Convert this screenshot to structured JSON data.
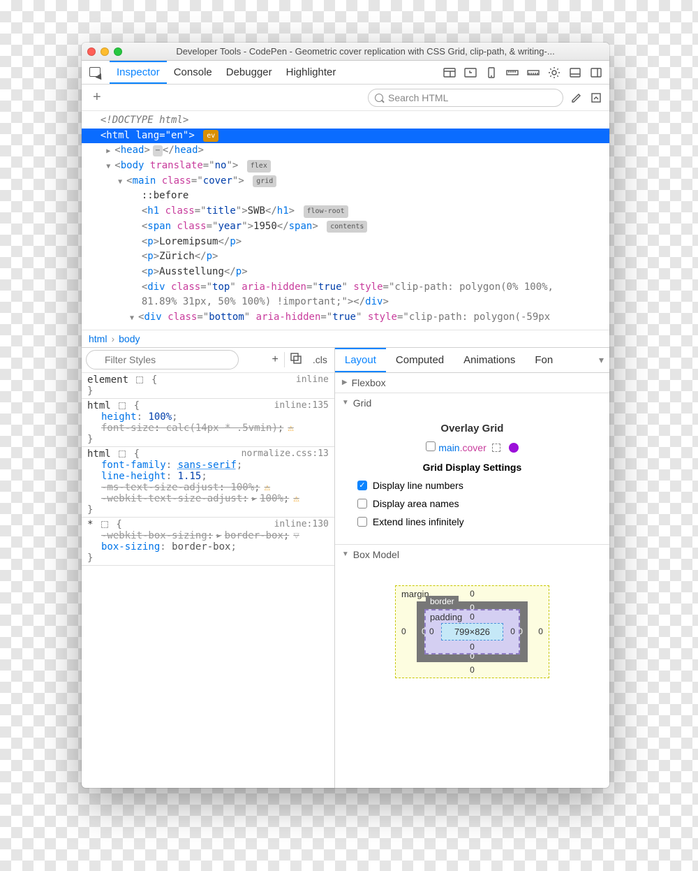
{
  "titlebar": {
    "title": "Developer Tools - CodePen - Geometric cover replication with CSS Grid, clip-path, & writing-..."
  },
  "tabs": {
    "items": [
      "Inspector",
      "Console",
      "Debugger",
      "Highlighter"
    ],
    "active": "Inspector"
  },
  "search": {
    "placeholder": "Search HTML"
  },
  "dom": {
    "doctype": "<!DOCTYPE html>",
    "html_attr": "lang",
    "html_val": "en",
    "ev": "ev",
    "head_open": "head",
    "head_ellipsis": "…",
    "body_attr": "translate",
    "body_val": "no",
    "body_badge": "flex",
    "main_class": "cover",
    "main_badge": "grid",
    "before": "::before",
    "h1_class": "title",
    "h1_text": "SWB",
    "h1_badge": "flow-root",
    "span_class": "year",
    "span_text": "1950",
    "span_badge": "contents",
    "p1": "Loremipsum",
    "p2": "Zürich",
    "p3": "Ausstellung",
    "top_class": "top",
    "top_ah": "true",
    "top_style1": "clip-path: polygon(0% 100%,",
    "top_style2": "81.89% 31px, 50% 100%) !important;",
    "bottom_class": "bottom",
    "bottom_ah": "true",
    "bottom_style": "clip-path: polygon(-59px"
  },
  "breadcrumbs": {
    "a": "html",
    "b": "body"
  },
  "rulesToolbar": {
    "filter": "Filter Styles",
    "cls": ".cls"
  },
  "rules": [
    {
      "selector": "element",
      "has_selbox": true,
      "src": "inline",
      "lines": []
    },
    {
      "selector": "html",
      "has_selbox": true,
      "src": "inline:135",
      "lines": [
        {
          "prop": "height",
          "val": "100%",
          "struck": false
        },
        {
          "prop": "font-size",
          "val": "calc(14px * .5vmin)",
          "struck": true,
          "warn": true
        }
      ]
    },
    {
      "selector": "html",
      "has_selbox": true,
      "src": "normalize.css:13",
      "lines": [
        {
          "prop": "font-family",
          "val": "sans-serif",
          "struck": false,
          "link": true
        },
        {
          "prop": "line-height",
          "val": "1.15",
          "struck": false
        },
        {
          "prop": "-ms-text-size-adjust",
          "val": "100%",
          "struck": true,
          "warn": true
        },
        {
          "prop": "-webkit-text-size-adjust",
          "val": "100%",
          "struck": true,
          "warn": true,
          "arrow": true
        }
      ]
    },
    {
      "selector": "*",
      "has_selbox": true,
      "src": "inline:130",
      "lines": [
        {
          "prop": "-webkit-box-sizing",
          "val": "border-box",
          "struck": true,
          "arrow": true,
          "filter": true
        },
        {
          "prop": "box-sizing",
          "val": "border-box",
          "struck": false
        }
      ]
    }
  ],
  "sideTabs": {
    "items": [
      "Layout",
      "Computed",
      "Animations",
      "Fon"
    ],
    "active": "Layout"
  },
  "flexbox": {
    "label": "Flexbox"
  },
  "grid": {
    "label": "Grid",
    "overlay_head": "Overlay Grid",
    "overlay_sel": "main",
    "overlay_cls": ".cover",
    "settings_head": "Grid Display Settings",
    "s1": "Display line numbers",
    "s2": "Display area names",
    "s3": "Extend lines infinitely"
  },
  "boxmodel": {
    "label": "Box Model",
    "margin": "margin",
    "border": "border",
    "padding": "padding",
    "content": "799×826",
    "m_top": "0",
    "m_right": "0",
    "m_bottom": "0",
    "m_left": "0",
    "b_top": "0",
    "b_right": "0",
    "b_bottom": "0",
    "b_left": "0",
    "p_top": "0",
    "p_right": "0",
    "p_bottom": "0",
    "p_left": "0"
  }
}
